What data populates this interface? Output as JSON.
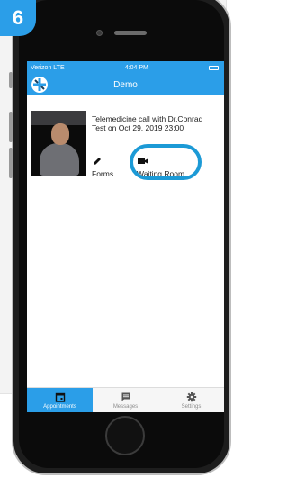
{
  "badge": {
    "step": "6"
  },
  "status": {
    "carrier": "Verizon LTE",
    "time": "4:04 PM"
  },
  "nav": {
    "title": "Demo"
  },
  "appointment": {
    "description": "Telemedicine call with Dr.Conrad Test on Oct 29, 2019 23:00",
    "actions": [
      {
        "label": "Forms",
        "icon": "pencil-icon"
      },
      {
        "label": "Waiting Room",
        "icon": "video-camera-icon"
      }
    ]
  },
  "tabs": [
    {
      "label": "Appointments",
      "icon": "calendar-icon",
      "active": true
    },
    {
      "label": "Messages",
      "icon": "message-icon",
      "active": false
    },
    {
      "label": "Settings",
      "icon": "gear-icon",
      "active": false
    }
  ],
  "colors": {
    "primary": "#2b9ee8",
    "highlight": "#1c9ad6"
  }
}
